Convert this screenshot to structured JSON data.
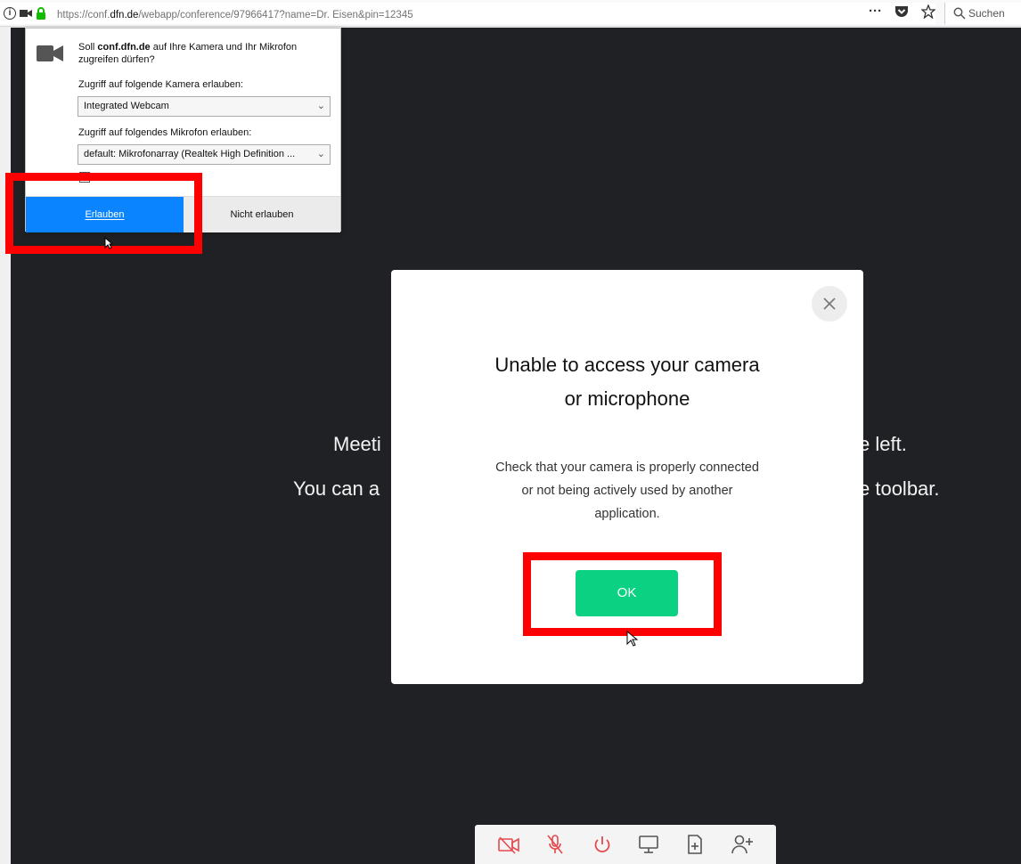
{
  "browser": {
    "url_prefix": "https://conf.",
    "url_domain": "dfn.de",
    "url_rest": "/webapp/conference/97966417?name=Dr. Eisen&pin=12345",
    "search_placeholder": "Suchen",
    "menu_dots": "···"
  },
  "permission": {
    "question_pre": "Soll ",
    "question_host": "conf.dfn.de",
    "question_post": " auf Ihre Kamera und Ihr Mikrofon zugreifen dürfen?",
    "camera_label": "Zugriff auf folgende Kamera erlauben:",
    "camera_value": "Integrated Webcam",
    "mic_label": "Zugriff auf folgendes Mikrofon erlauben:",
    "mic_value": "default: Mikrofonarray (Realtek High Definition ...",
    "allow_label": "Erlauben",
    "deny_label": "Nicht erlauben"
  },
  "background": {
    "line1_left": "Meeti",
    "line1_right": "e left.",
    "line2_left": "You can a",
    "line2_right": "e toolbar."
  },
  "modal": {
    "title_line1": "Unable to access your camera",
    "title_line2": "or microphone",
    "body_line1": "Check that your camera is properly connected",
    "body_line2": "or not being actively used by another",
    "body_line3": "application.",
    "ok_label": "OK"
  },
  "colors": {
    "allow_button": "#0a84ff",
    "ok_button": "#0bd282",
    "highlight": "#ff0000",
    "toolbar_icon_off": "#e5484d",
    "toolbar_icon": "#555555"
  },
  "toolbar": {
    "icons": [
      "camera-off-icon",
      "microphone-off-icon",
      "power-icon",
      "screen-share-icon",
      "add-document-icon",
      "add-person-icon"
    ]
  }
}
